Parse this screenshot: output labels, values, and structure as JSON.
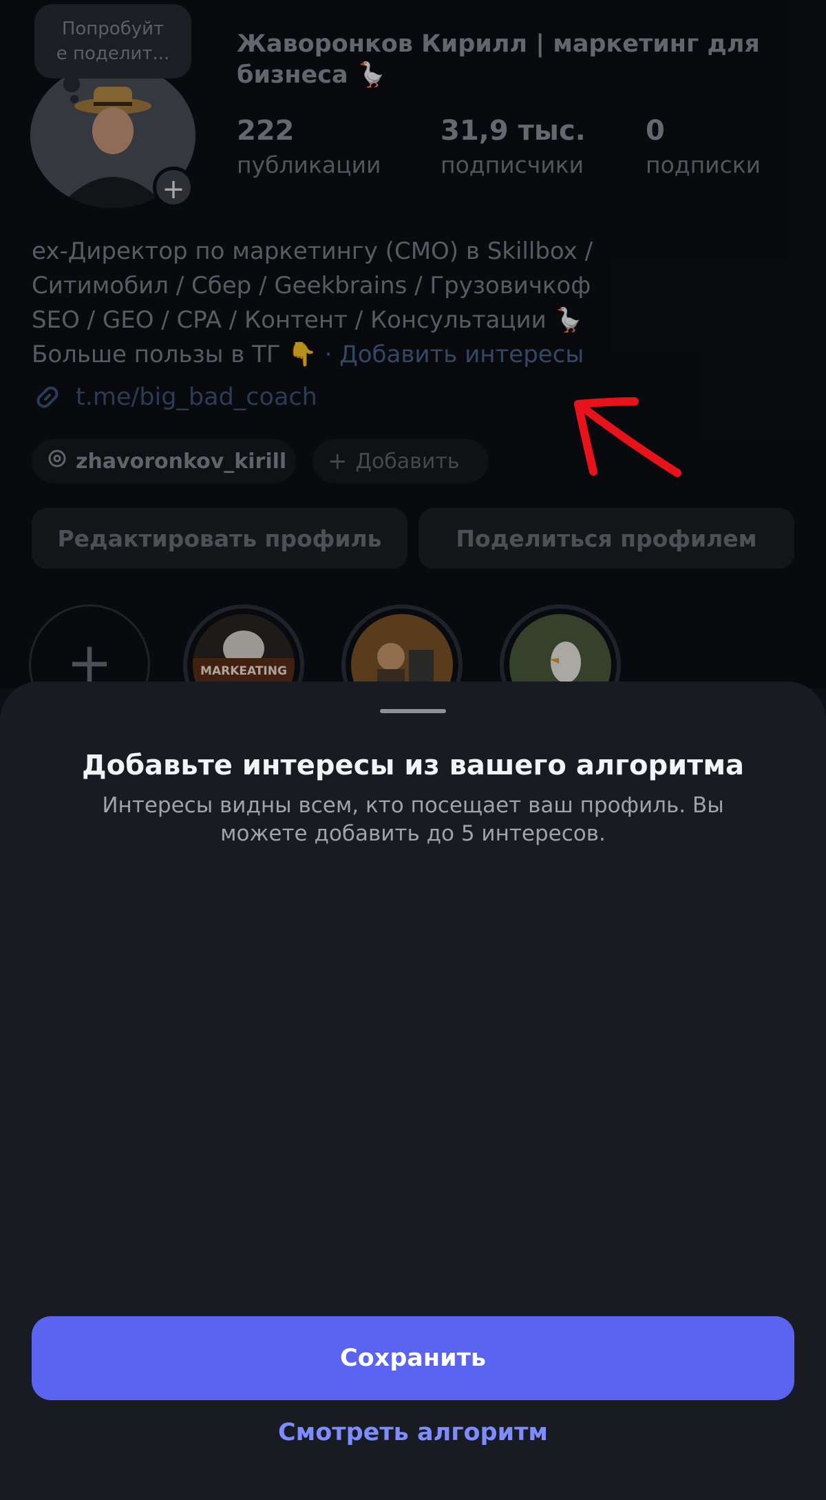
{
  "profile": {
    "note_bubble": "Попробуйт\nе поделит...",
    "display_name": "Жаворонков Кирилл | маркетинг для бизнеса 🪿",
    "stats": [
      {
        "value": "222",
        "label": "публикации"
      },
      {
        "value": "31,9 тыс.",
        "label": "подписчики"
      },
      {
        "value": "0",
        "label": "подписки"
      }
    ],
    "bio_lines": [
      "ex-Директор по маркетингу (CMO) в Skillbox /",
      "Ситимобил / Сбер / Geekbrains / Грузовичкоф",
      "SEO / GEO / CPA / Контент / Консультации 🪿",
      "Больше пользы в ТГ 👇"
    ],
    "add_interests": "· Добавить интересы",
    "link": "t.me/big_bad_coach",
    "threads_handle": "zhavoronkov_kirill",
    "add_chip": "Добавить",
    "edit_button": "Редактировать профиль",
    "share_button": "Поделиться профилем",
    "highlight_label": "MARKEATING"
  },
  "sheet": {
    "title": "Добавьте интересы из вашего алгоритма",
    "subtitle": "Интересы видны всем, кто посещает ваш профиль. Вы можете добавить до 5 интересов.",
    "save_button": "Сохранить",
    "view_algorithm": "Смотреть алгоритм"
  },
  "colors": {
    "accent": "#5b64f0",
    "link": "#7e8cff",
    "annotation_arrow": "#e8121a"
  },
  "icons": [
    "plus-icon",
    "link-icon",
    "threads-icon",
    "add-icon",
    "new-highlight-plus-icon"
  ]
}
